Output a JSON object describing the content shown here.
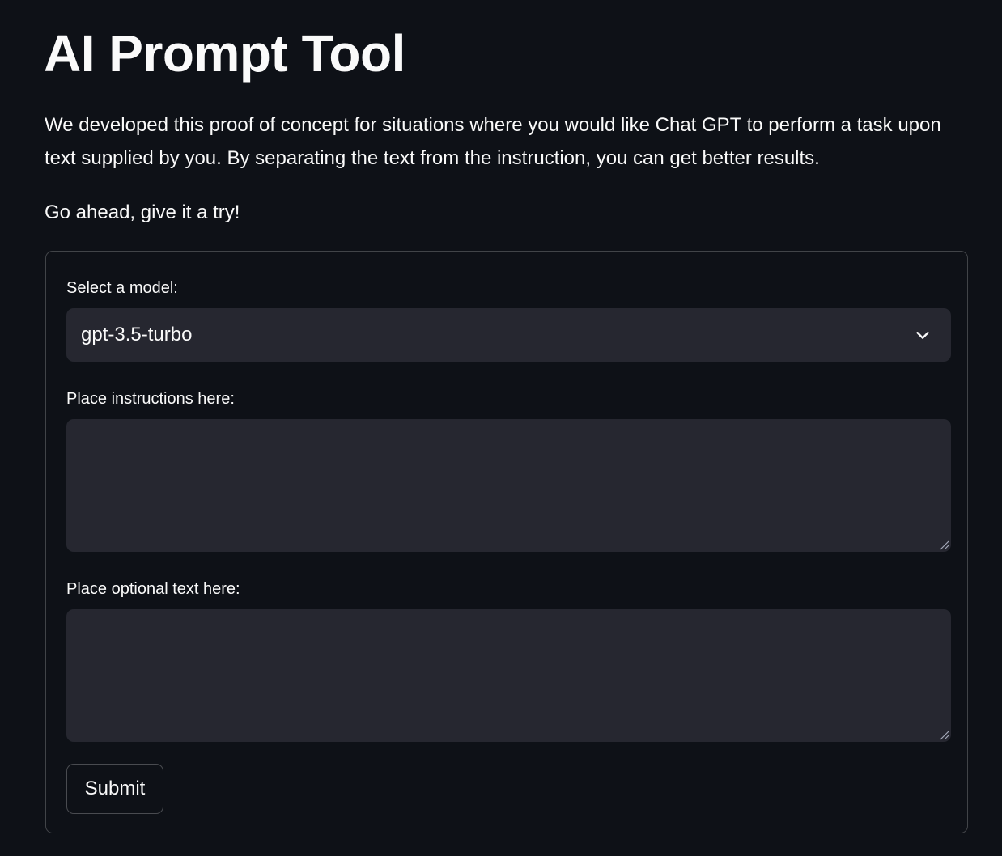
{
  "header": {
    "title": "AI Prompt Tool"
  },
  "intro": {
    "description": "We developed this proof of concept for situations where you would like Chat GPT to perform a task upon text supplied by you. By separating the text from the instruction, you can get better results.",
    "call_to_action": "Go ahead, give it a try!"
  },
  "form": {
    "model_select": {
      "label": "Select a model:",
      "selected_value": "gpt-3.5-turbo",
      "icon": "chevron-down-icon"
    },
    "instructions": {
      "label": "Place instructions here:",
      "value": "",
      "icon": "resize-grip-icon"
    },
    "optional_text": {
      "label": "Place optional text here:",
      "value": "",
      "icon": "resize-grip-icon"
    },
    "submit_label": "Submit"
  },
  "colors": {
    "background": "#0e1117",
    "input_background": "#262730",
    "text": "#fafafa"
  }
}
